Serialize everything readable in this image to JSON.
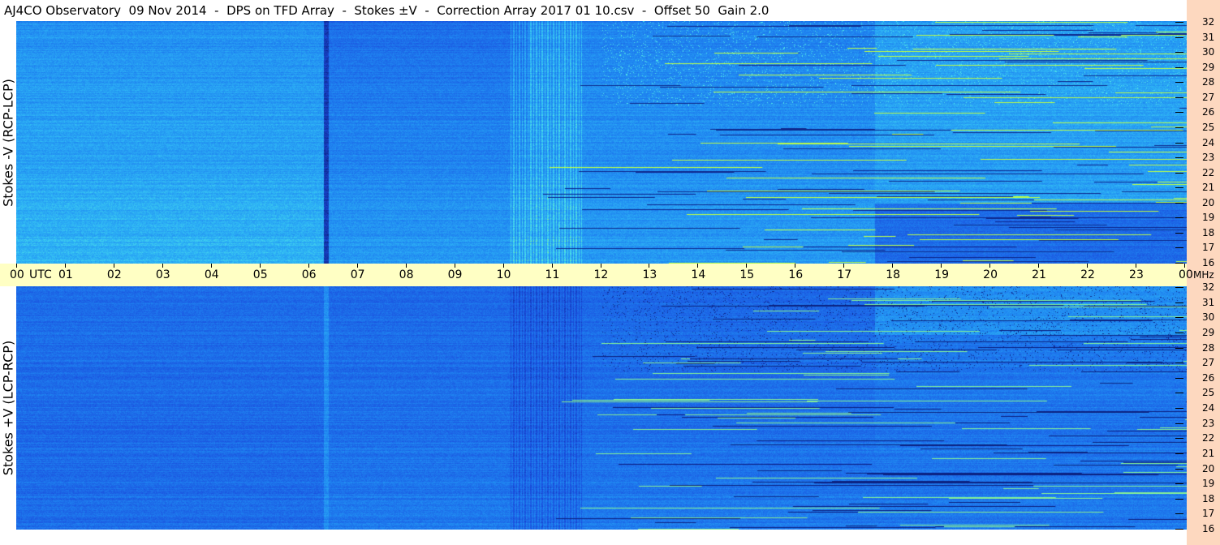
{
  "title": "AJ4CO Observatory  09 Nov 2014  -  DPS on TFD Array  -  Stokes ±V  -  Correction Array 2017 01 10.csv  -  Offset 50  Gain 2.0",
  "chart_data": [
    {
      "type": "heatmap",
      "panel": "top",
      "ylabel": "Stokes -V (RCP-LCP)",
      "xlabel": "",
      "x_ticks": [
        "00",
        "01",
        "02",
        "03",
        "04",
        "05",
        "06",
        "07",
        "08",
        "09",
        "10",
        "11",
        "12",
        "13",
        "14",
        "15",
        "16",
        "17",
        "18",
        "19",
        "20",
        "21",
        "22",
        "23",
        "00"
      ],
      "x_unit_label": "UTC",
      "y_ticks": [
        "32",
        "31",
        "30",
        "29",
        "28",
        "27",
        "26",
        "25",
        "24",
        "23",
        "22",
        "21",
        "20",
        "19",
        "18",
        "17",
        "16"
      ],
      "y_unit_label": "MHz",
      "xlim": [
        0,
        24
      ],
      "ylim": [
        16,
        32
      ]
    },
    {
      "type": "heatmap",
      "panel": "bottom",
      "ylabel": "Stokes +V (LCP-RCP)",
      "xlabel": "",
      "x_ticks": [
        "00",
        "01",
        "02",
        "03",
        "04",
        "05",
        "06",
        "07",
        "08",
        "09",
        "10",
        "11",
        "12",
        "13",
        "14",
        "15",
        "16",
        "17",
        "18",
        "19",
        "20",
        "21",
        "22",
        "23",
        "00"
      ],
      "y_ticks": [
        "32",
        "31",
        "30",
        "29",
        "28",
        "27",
        "26",
        "25",
        "24",
        "23",
        "22",
        "21",
        "20",
        "19",
        "18",
        "17",
        "16"
      ],
      "xlim": [
        0,
        24
      ],
      "ylim": [
        16,
        32
      ]
    }
  ],
  "colors": {
    "spectro_dark": "#1a4fdc",
    "spectro_mid": "#1f8bf0",
    "spectro_light": "#2fb4f5",
    "spectro_hot": "#c8ff40",
    "time_bar": "#ffffc4",
    "right_strip": "#fdd8bf"
  }
}
